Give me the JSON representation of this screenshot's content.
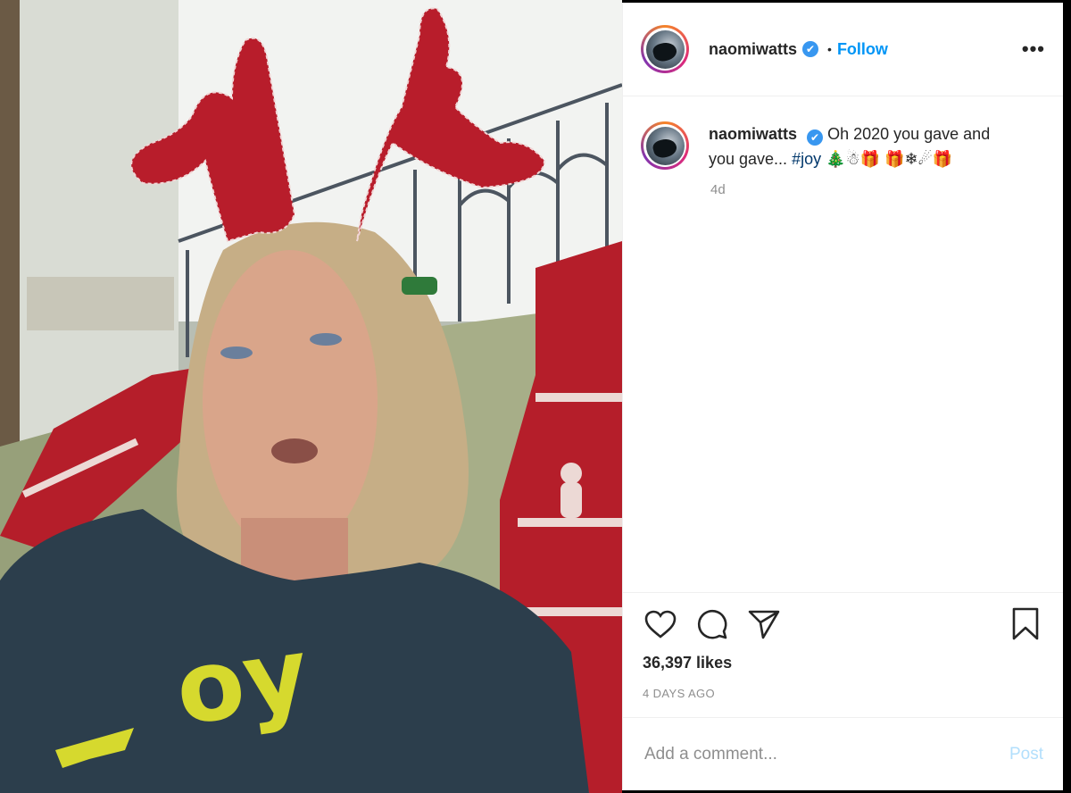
{
  "post": {
    "photo_alt": "",
    "header": {
      "username": "naomiwatts",
      "verified_mark": "✔",
      "dot": "•",
      "follow_label": "Follow",
      "more_icon": "more-options-icon",
      "more_label": "•••"
    },
    "caption": {
      "username": "naomiwatts",
      "text": "Oh 2020 you gave and you gave... ",
      "hashtag": "#joy",
      "emoji": " 🎄☃🎁 🎁❄☄🎁",
      "time": "4d"
    },
    "actions": {
      "icons": [
        "heart-icon",
        "comment-icon",
        "share-icon",
        "bookmark-icon"
      ],
      "likes": "36,397 likes",
      "date": "4 DAYS AGO"
    },
    "comment": {
      "placeholder": "Add a comment...",
      "post_label": "Post"
    },
    "colors": {
      "follow": "#0095f6",
      "verified": "#3897f0",
      "post_disabled": "#b2dffc"
    }
  }
}
